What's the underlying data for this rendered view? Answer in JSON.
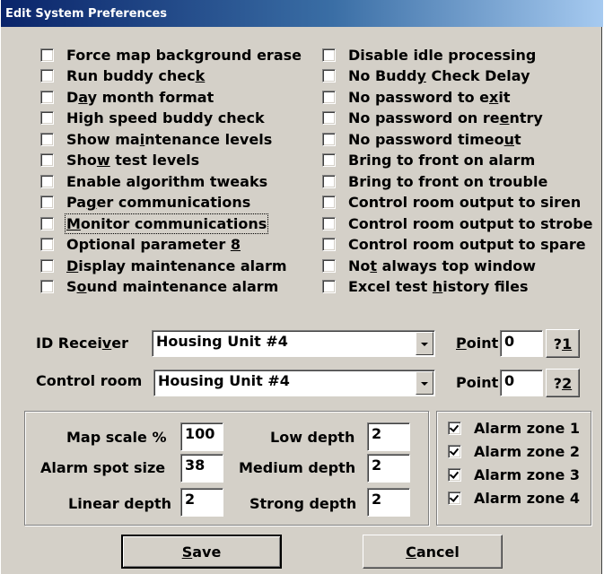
{
  "window": {
    "title": "Edit System Preferences"
  },
  "left_checks": [
    {
      "pre": "Force map background erase",
      "ul": "",
      "post": "",
      "checked": false
    },
    {
      "pre": "Run buddy chec",
      "ul": "k",
      "post": "",
      "checked": false
    },
    {
      "pre": "D",
      "ul": "a",
      "post": "y month format",
      "checked": false
    },
    {
      "pre": "High speed buddy check",
      "ul": "",
      "post": "",
      "checked": false
    },
    {
      "pre": "Show ma",
      "ul": "i",
      "post": "ntenance levels",
      "checked": false
    },
    {
      "pre": "Sho",
      "ul": "w",
      "post": " test levels",
      "checked": false
    },
    {
      "pre": "Enable algorithm tweaks",
      "ul": "",
      "post": "",
      "checked": false
    },
    {
      "pre": "Pa",
      "ul": "g",
      "post": "er communications",
      "checked": false
    },
    {
      "pre": "",
      "ul": "M",
      "post": "onitor communications",
      "checked": false
    },
    {
      "pre": "Optional parameter ",
      "ul": "8",
      "post": "",
      "checked": false
    },
    {
      "pre": "",
      "ul": "D",
      "post": "isplay maintenance alarm",
      "checked": false
    },
    {
      "pre": "S",
      "ul": "o",
      "post": "und maintenance alarm",
      "checked": false
    }
  ],
  "right_checks": [
    {
      "pre": "Disable idle processing",
      "ul": "",
      "post": "",
      "checked": false
    },
    {
      "pre": "No Budd",
      "ul": "y",
      "post": " Check Delay",
      "checked": false
    },
    {
      "pre": "No password to e",
      "ul": "x",
      "post": "it",
      "checked": false
    },
    {
      "pre": "No password on re",
      "ul": "e",
      "post": "ntry",
      "checked": false
    },
    {
      "pre": "No password timeo",
      "ul": "u",
      "post": "t",
      "checked": false
    },
    {
      "pre": "Bring to front on alarm",
      "ul": "",
      "post": "",
      "checked": false
    },
    {
      "pre": "Bring to front on trouble",
      "ul": "",
      "post": "",
      "checked": false
    },
    {
      "pre": "Control room output to siren",
      "ul": "",
      "post": "",
      "checked": false
    },
    {
      "pre": "Control room output to strobe",
      "ul": "",
      "post": "",
      "checked": false
    },
    {
      "pre": "Control room output to spare",
      "ul": "",
      "post": "",
      "checked": false
    },
    {
      "pre": "No",
      "ul": "t",
      "post": " always top window",
      "checked": false
    },
    {
      "pre": "Excel test ",
      "ul": "h",
      "post": "istory files",
      "checked": false
    }
  ],
  "id_receiver": {
    "label_pre": "ID Recei",
    "label_ul": "v",
    "label_post": "er",
    "value": "Housing Unit #4",
    "point_label_ul": "P",
    "point_label_post": "oint",
    "point_value": "0",
    "help_pre": "?",
    "help_ul": "1"
  },
  "control_room": {
    "label": "Control room",
    "value": "Housing Unit #4",
    "point_label": "Point",
    "point_value": "0",
    "help_pre": "?",
    "help_ul": "2"
  },
  "settings": {
    "map_scale_label": "Map scale %",
    "map_scale": "100",
    "alarm_spot_label": "Alarm spot size",
    "alarm_spot": "38",
    "linear_label": "Linear depth",
    "linear": "2",
    "low_label": "Low depth",
    "low": "2",
    "medium_label": "Medium depth",
    "medium": "2",
    "strong_label": "Strong depth",
    "strong": "2"
  },
  "alarm_zones": [
    {
      "label": "Alarm zone 1",
      "checked": true
    },
    {
      "label": "Alarm zone 2",
      "checked": true
    },
    {
      "label": "Alarm zone 3",
      "checked": true
    },
    {
      "label": "Alarm zone 4",
      "checked": true
    }
  ],
  "buttons": {
    "save_ul": "S",
    "save_post": "ave",
    "cancel_ul": "C",
    "cancel_post": "ancel"
  }
}
